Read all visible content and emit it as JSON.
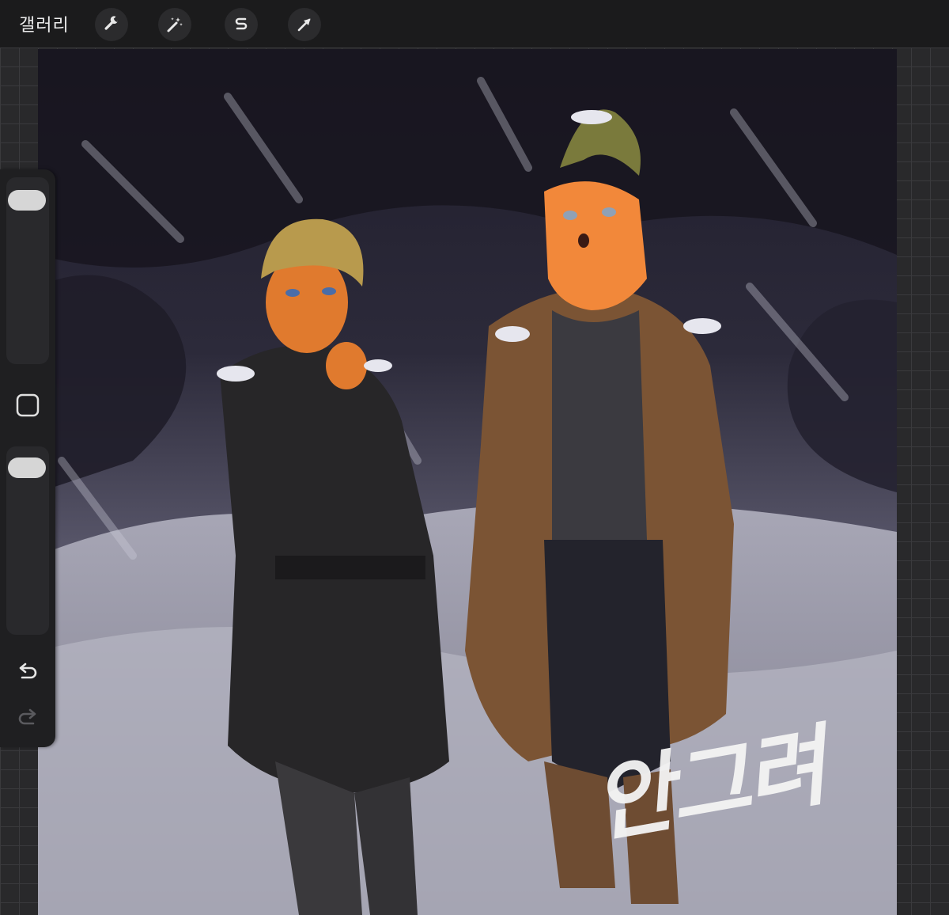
{
  "topbar": {
    "gallery_label": "갤러리",
    "tools": [
      {
        "name": "wrench-icon",
        "action": "actions"
      },
      {
        "name": "magic-wand-icon",
        "action": "adjustments"
      },
      {
        "name": "selection-s-icon",
        "action": "selection"
      },
      {
        "name": "transform-arrow-icon",
        "action": "transform"
      }
    ]
  },
  "sidebar": {
    "brush_size_level": 0.06,
    "opacity_level": 0.05,
    "modify_button_icon": "square-icon",
    "undo_icon": "undo-icon",
    "redo_icon": "redo-icon"
  },
  "canvas": {
    "caption_text": "안그려"
  },
  "colors": {
    "toolbar_bg": "#1b1b1c",
    "workspace_bg": "#29292b",
    "accent_white": "#ececec"
  }
}
